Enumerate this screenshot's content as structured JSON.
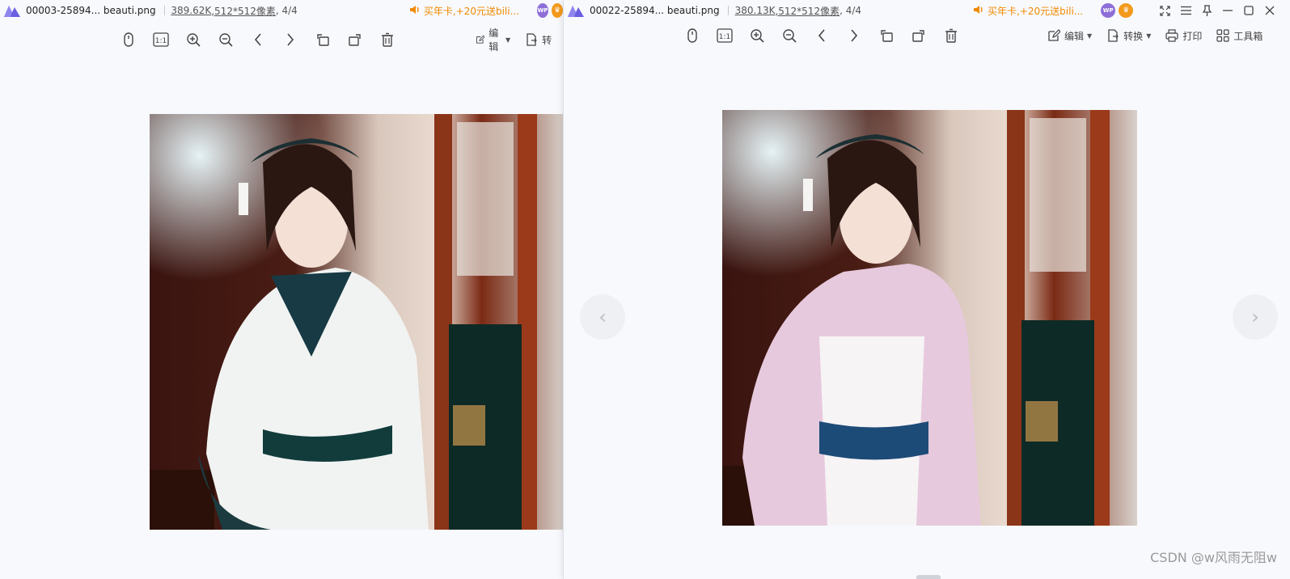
{
  "left_viewer": {
    "filename": "00003-25894... beauti.png",
    "filesize": "389.62K",
    "dimensions": ",512*512像素",
    "page_counter": ", 4/4",
    "promo": "买年卡,+20元送bili...",
    "badge_wp": "WP",
    "edit_label": "编辑",
    "convert_partial": "转"
  },
  "right_viewer": {
    "filename": "00022-25894... beauti.png",
    "filesize": "380.13K",
    "dimensions": ",512*512像素",
    "page_counter": ", 4/4",
    "promo": "买年卡,+20元送bili...",
    "badge_wp": "WP",
    "edit_label": "编辑",
    "convert_label": "转换",
    "print_label": "打印",
    "tools_label": "工具箱",
    "prev_arrow": "‹",
    "next_arrow": "›"
  },
  "watermark": "CSDN @w风雨无阻w",
  "icons": {
    "toolbar": [
      "mouse-icon",
      "actual-size-icon",
      "zoom-in-icon",
      "zoom-out-icon",
      "prev-icon",
      "next-icon",
      "rotate-left-icon",
      "rotate-right-icon",
      "delete-icon"
    ],
    "window_controls": [
      "fullscreen-icon",
      "menu-icon",
      "pin-icon",
      "minimize-icon",
      "maximize-icon",
      "close-icon"
    ]
  },
  "colors": {
    "accent_promo": "#f08a00",
    "background": "#f8f9fd",
    "badge_purple": "#8e6fd8",
    "badge_orange": "#f39a1d"
  }
}
